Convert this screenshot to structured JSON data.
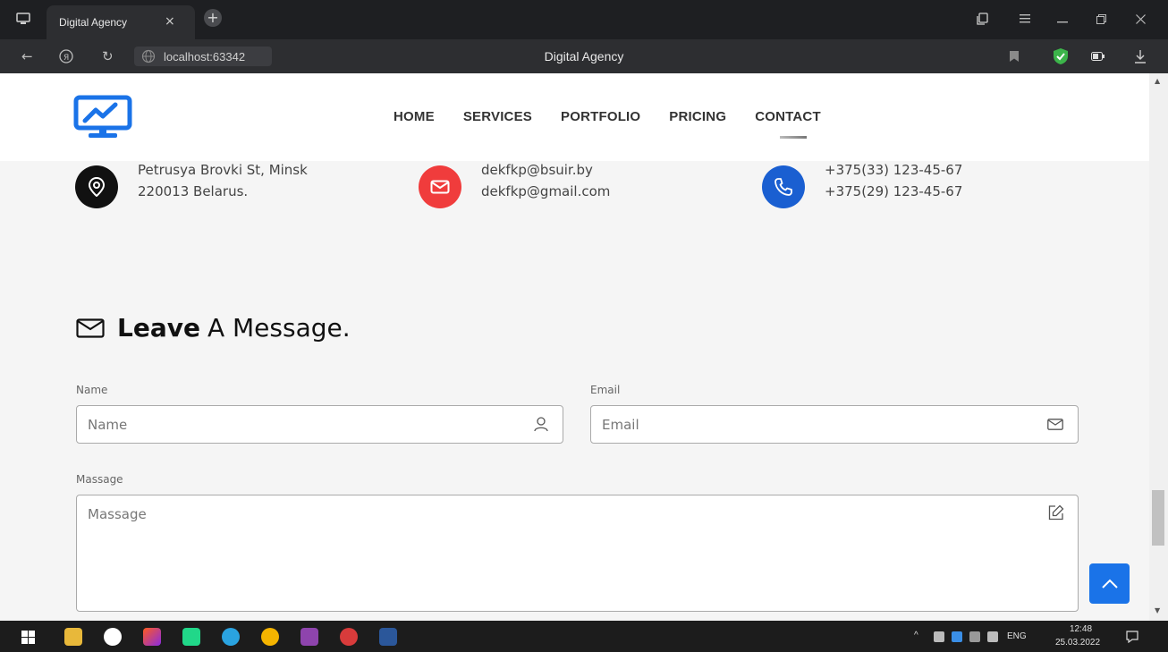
{
  "browser": {
    "tab_title": "Digital Agency",
    "tab_close": "×",
    "new_tab": "+",
    "url": "localhost:63342",
    "page_title": "Digital Agency"
  },
  "nav": {
    "items": [
      {
        "label": "HOME"
      },
      {
        "label": "SERVICES"
      },
      {
        "label": "PORTFOLIO"
      },
      {
        "label": "PRICING"
      },
      {
        "label": "CONTACT"
      }
    ],
    "active_index": 4
  },
  "contact": {
    "address_line1": "Petrusya Brovki St, Minsk",
    "address_line2": "220013 Belarus.",
    "email_line1": "dekfkp@bsuir.by",
    "email_line2": "dekfkp@gmail.com",
    "phone_line1": "+375(33) 123-45-67",
    "phone_line2": "+375(29) 123-45-67"
  },
  "form": {
    "title_bold": "Leave",
    "title_rest": "A Message.",
    "name_label": "Name",
    "name_placeholder": "Name",
    "email_label": "Email",
    "email_placeholder": "Email",
    "message_label": "Massage",
    "message_placeholder": "Massage"
  },
  "taskbar": {
    "lang": "ENG",
    "time": "12:48",
    "date": "25.03.2022"
  },
  "colors": {
    "accent_blue": "#1a73e8",
    "email_red": "#f03c3c",
    "address_black": "#111111",
    "phone_blue": "#1a5fd1"
  }
}
